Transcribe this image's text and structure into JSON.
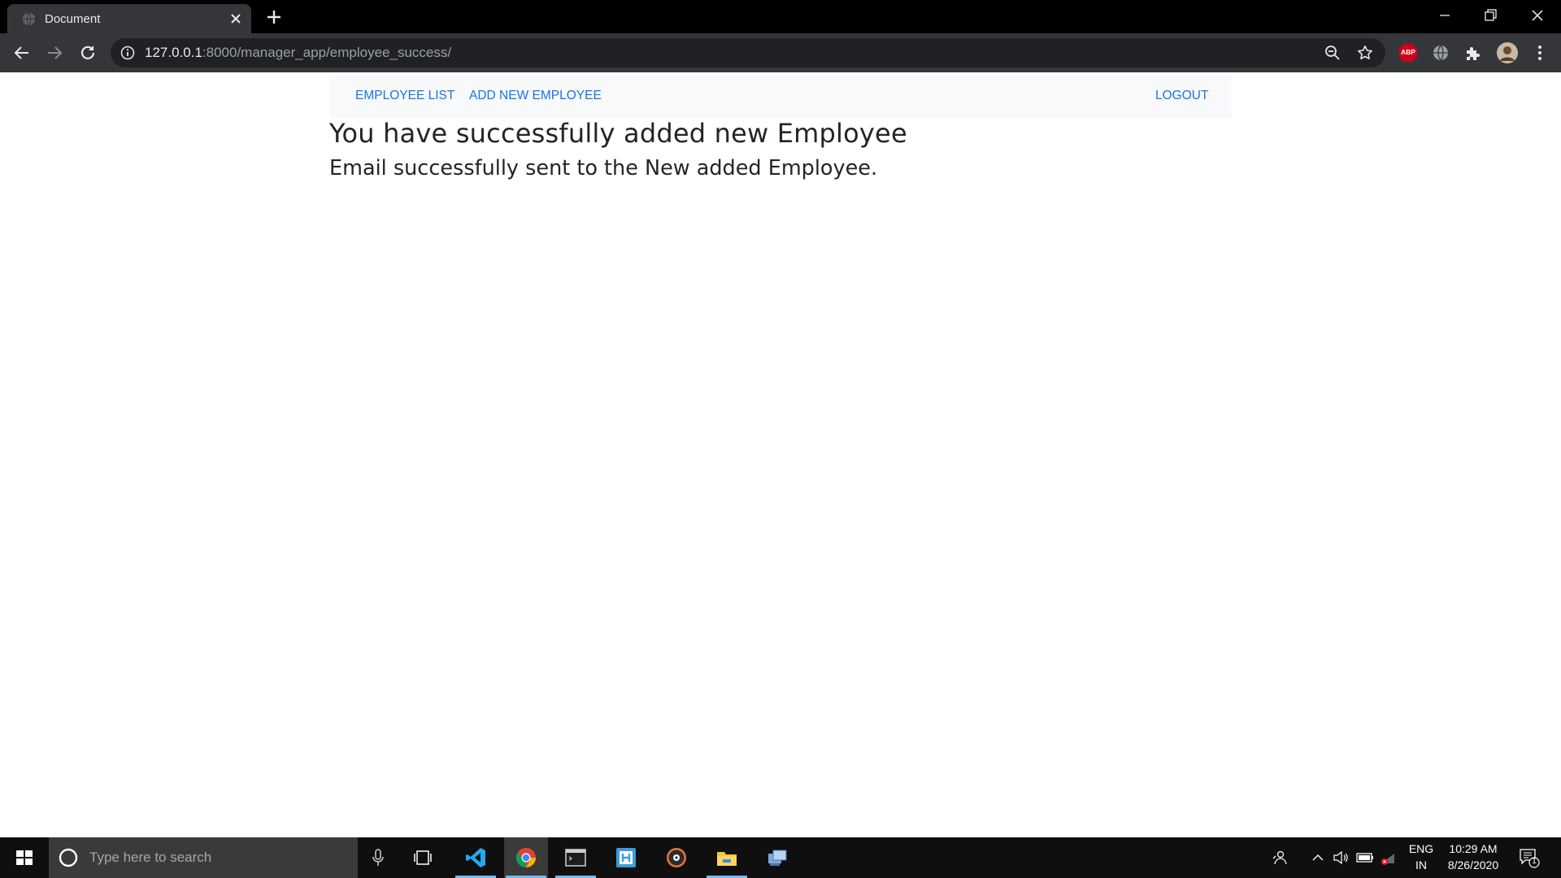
{
  "browser": {
    "tab_title": "Document",
    "url_host": "127.0.0.1",
    "url_rest": ":8000/manager_app/employee_success/"
  },
  "navbar": {
    "employee_list": "EMPLOYEE LIST",
    "add_new_employee": "ADD NEW EMPLOYEE",
    "logout": "LOGOUT"
  },
  "main": {
    "heading": "You have successfully added new Employee",
    "subheading": "Email successfully sent to the New added Employee."
  },
  "taskbar": {
    "search_placeholder": "Type here to search",
    "language_line1": "ENG",
    "language_line2": "IN",
    "time": "10:29 AM",
    "date": "8/26/2020",
    "notification_count": "1",
    "apps": [
      "vscode-icon",
      "chrome-icon",
      "terminal-icon",
      "app-icon",
      "media-player-icon",
      "file-explorer-icon",
      "network-app-icon"
    ]
  },
  "extensions": {
    "abp_label": "ABP"
  },
  "colors": {
    "link": "#1a73e8",
    "navbar_bg": "#f8f9fa",
    "text": "#212529",
    "chrome_dark": "#35363a",
    "taskbar": "#0f0f0f",
    "accent_underline": "#76b9ed"
  }
}
